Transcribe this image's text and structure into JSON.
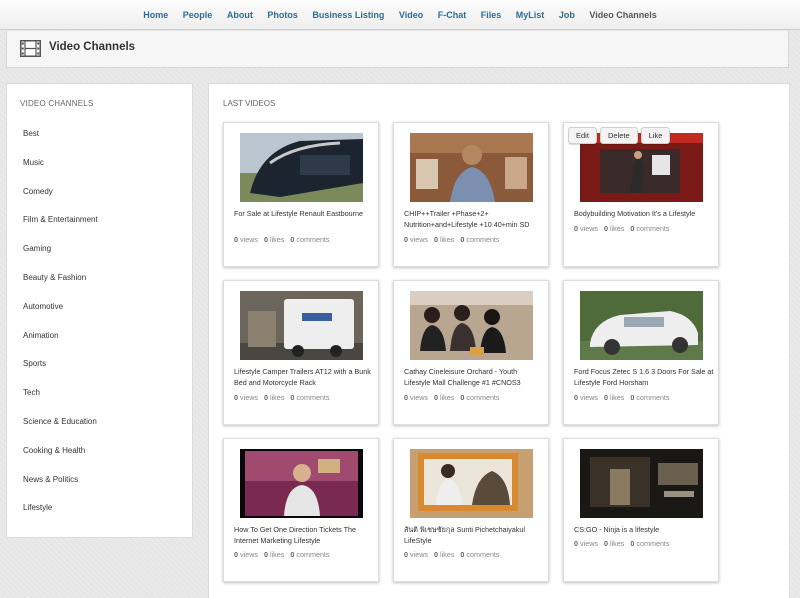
{
  "nav": {
    "home": "Home",
    "people": "People",
    "about": "About",
    "photos": "Photos",
    "business": "Business Listing",
    "video": "Video",
    "fchat": "F-Chat",
    "files": "Files",
    "mylist": "MyList",
    "job": "Job",
    "channels": "Video Channels"
  },
  "header": {
    "title": "Video Channels",
    "icon": "film-icon"
  },
  "sidebar": {
    "heading": "VIDEO CHANNELS",
    "items": [
      {
        "label": "Best"
      },
      {
        "label": "Music"
      },
      {
        "label": "Comedy"
      },
      {
        "label": "Film & Entertainment"
      },
      {
        "label": "Gaming"
      },
      {
        "label": "Beauty & Fashion"
      },
      {
        "label": "Automotive"
      },
      {
        "label": "Animation"
      },
      {
        "label": "Sports"
      },
      {
        "label": "Tech"
      },
      {
        "label": "Science & Education"
      },
      {
        "label": "Cooking & Health"
      },
      {
        "label": "News & Politics"
      },
      {
        "label": "Lifestyle"
      }
    ]
  },
  "main": {
    "heading": "LAST VIDEOS",
    "stat_views": "views",
    "stat_likes": "likes",
    "stat_comments": "comments",
    "card_actions": {
      "edit": "Edit",
      "delete": "Delete",
      "like": "Like"
    },
    "videos": [
      {
        "title": "For Sale at Lifestyle Renault Eastbourne",
        "views": "0",
        "likes": "0",
        "comments": "0"
      },
      {
        "title": "CHIP++Trailer +Phase+2+ Nutrition+and+Lifestyle +10 40+min SD",
        "views": "0",
        "likes": "0",
        "comments": "0"
      },
      {
        "title": "Bodybuilding Motivation It's a Lifestyle",
        "views": "0",
        "likes": "0",
        "comments": "0"
      },
      {
        "title": "Lifestyle Camper Trailers AT12 with a Bunk Bed and Motorcycle Rack",
        "views": "0",
        "likes": "0",
        "comments": "0"
      },
      {
        "title": "Cathay Cineleisure Orchard - Youth Lifestyle Mall Challenge #1 #CNOS3",
        "views": "0",
        "likes": "0",
        "comments": "0"
      },
      {
        "title": "Ford Focus Zetec S 1.6 3 Doors For Sale at Lifestyle Ford Horsham",
        "views": "0",
        "likes": "0",
        "comments": "0"
      },
      {
        "title": "How To Get One Direction Tickets The Internet Marketing Lifestyle",
        "views": "0",
        "likes": "0",
        "comments": "0"
      },
      {
        "title": "สันติ พิเชษชัยกุล Sunti Pichetchaiyakul LifeStyle",
        "views": "0",
        "likes": "0",
        "comments": "0"
      },
      {
        "title": "CS:GO - Ninja is a lifestyle",
        "views": "0",
        "likes": "0",
        "comments": "0"
      }
    ]
  }
}
